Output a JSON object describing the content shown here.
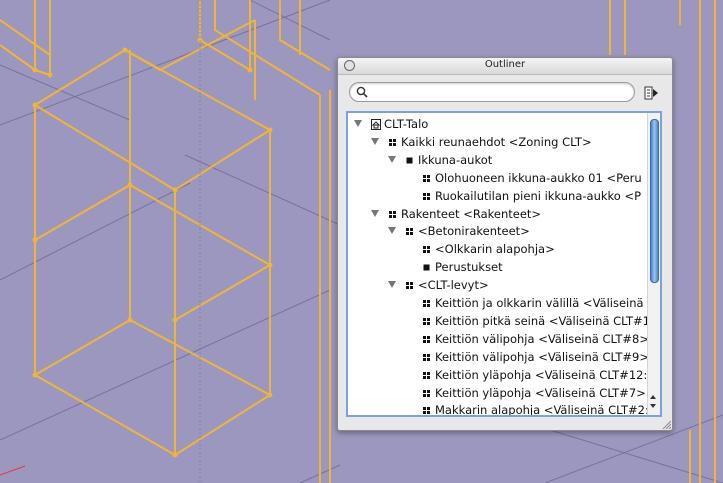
{
  "outliner": {
    "title": "Outliner",
    "search_placeholder": "",
    "rows": [
      {
        "label": "CLT-Talo",
        "level": 0,
        "expanded": true,
        "icon": "house-icon"
      },
      {
        "label": "Kaikki reunaehdot <Zoning CLT>",
        "level": 1,
        "expanded": true,
        "icon": "component-icon"
      },
      {
        "label": "Ikkuna-aukot",
        "level": 2,
        "expanded": true,
        "icon": "group-icon"
      },
      {
        "label": "Olohuoneen ikkuna-aukko 01 <Peru",
        "level": 3,
        "expanded": null,
        "icon": "component-icon"
      },
      {
        "label": "Ruokailutilan pieni ikkuna-aukko <P",
        "level": 3,
        "expanded": null,
        "icon": "component-icon"
      },
      {
        "label": "Rakenteet <Rakenteet>",
        "level": 1,
        "expanded": true,
        "icon": "component-icon"
      },
      {
        "label": "<Betonirakenteet>",
        "level": 2,
        "expanded": true,
        "icon": "component-icon"
      },
      {
        "label": "<Olkkarin alapohja>",
        "level": 3,
        "expanded": null,
        "icon": "component-icon"
      },
      {
        "label": "Perustukset",
        "level": 3,
        "expanded": null,
        "icon": "group-icon"
      },
      {
        "label": "<CLT-levyt>",
        "level": 2,
        "expanded": true,
        "icon": "component-icon"
      },
      {
        "label": "Keittiön ja olkkarin välillä <Väliseinä",
        "level": 3,
        "expanded": null,
        "icon": "component-icon"
      },
      {
        "label": "Keittiön pitkä seinä <Väliseinä CLT#1",
        "level": 3,
        "expanded": null,
        "icon": "component-icon"
      },
      {
        "label": "Keittiön välipohja <Väliseinä CLT#8>",
        "level": 3,
        "expanded": null,
        "icon": "component-icon"
      },
      {
        "label": "Keittiön välipohja <Väliseinä CLT#9>",
        "level": 3,
        "expanded": null,
        "icon": "component-icon"
      },
      {
        "label": "Keittiön yläpohja <Väliseinä CLT#12:",
        "level": 3,
        "expanded": null,
        "icon": "component-icon"
      },
      {
        "label": "Keittiön yläpohja <Väliseinä CLT#7>",
        "level": 3,
        "expanded": null,
        "icon": "component-icon"
      },
      {
        "label": "Makkarin alapohja <Väliseinä CLT#2:",
        "level": 3,
        "expanded": null,
        "icon": "component-icon"
      }
    ]
  },
  "colors": {
    "background": "#9c97be",
    "geometry": "#f0b43a",
    "selection_border": "#7da2d4",
    "scroll_thumb": "#4c82c9"
  }
}
